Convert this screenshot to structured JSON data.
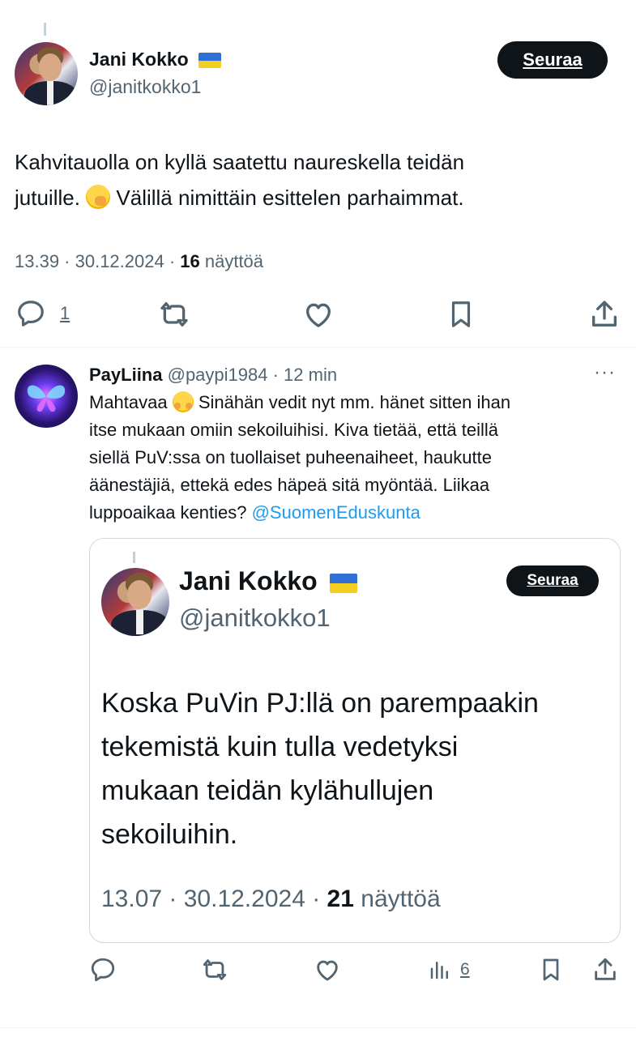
{
  "main_tweet": {
    "author_name": "Jani Kokko",
    "handle": "@janitkokko1",
    "follow_label": "Seuraa",
    "text_line1": "Kahvitauolla on kyllä saatettu naureskella teidän",
    "text_line2a": "jutuille. ",
    "text_line2b": " Välillä nimittäin esittelen parhaimmat.",
    "time": "13.39 · 30.12.2024 · ",
    "views_count": "16",
    "views_label": " näyttöä",
    "reply_count": "1"
  },
  "reply": {
    "author_name": "PayLiina",
    "handle": "@paypi1984",
    "time": " · 12 min",
    "more": "···",
    "text_1": "Mahtavaa ",
    "text_2": " Sinähän vedit nyt mm. hänet sitten ihan",
    "lines": [
      "itse mukaan omiin sekoiluihisi. Kiva tietää, että teillä",
      "siellä PuV:ssa on tuollaiset puheenaiheet, haukutte",
      "äänestäjiä, ettekä edes häpeä sitä myöntää. Liikaa"
    ],
    "last_line_text": "luppoaikaa kenties? ",
    "mention": "@SuomenEduskunta",
    "views_count": "6"
  },
  "quoted": {
    "author_name": "Jani Kokko",
    "handle": "@janitkokko1",
    "follow_label": "Seuraa",
    "lines": [
      "Koska PuVin PJ:llä on parempaakin",
      "tekemistä kuin tulla vedetyksi",
      "mukaan teidän kylähullujen",
      "sekoiluihin."
    ],
    "time": "13.07 · 30.12.2024 · ",
    "views_count": "21",
    "views_label": " näyttöä"
  },
  "colors": {
    "text": "#0f1419",
    "muted": "#536471",
    "link": "#1d9bf0",
    "button_bg": "#0f1419",
    "flag_blue": "#2f6fd6",
    "flag_yellow": "#f5cf1f"
  },
  "icons": [
    "reply-icon",
    "retweet-icon",
    "like-icon",
    "bookmark-icon",
    "share-icon",
    "views-icon",
    "more-icon"
  ]
}
